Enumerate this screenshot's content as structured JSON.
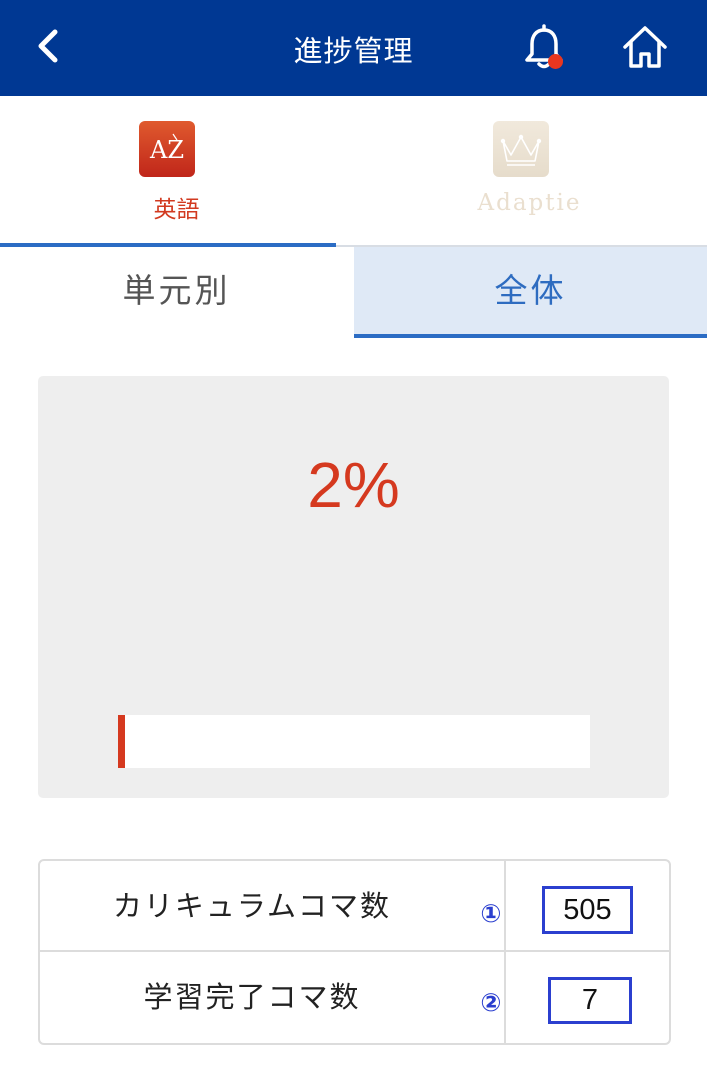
{
  "header": {
    "title": "進捗管理",
    "back_icon": "chevron-left-icon",
    "bell_icon": "bell-icon",
    "home_icon": "home-icon",
    "notification_color": "#e8361f",
    "background_color": "#003893"
  },
  "subjects": [
    {
      "id": "english",
      "label": "英語",
      "icon": "az-book-icon",
      "logo_text": "AZ",
      "selected": true,
      "color": "#d23a20"
    },
    {
      "id": "adaptie",
      "label": "Adaptie",
      "icon": "crown-icon",
      "selected": false,
      "color": "#eadfcf"
    }
  ],
  "view_tabs": [
    {
      "label": "単元別",
      "selected": false
    },
    {
      "label": "全体",
      "selected": true
    }
  ],
  "progress": {
    "percent_text": "2%",
    "fraction": 0.014,
    "color": "#d5391f"
  },
  "stats": [
    {
      "label": "カリキュラムコマ数",
      "marker": "①",
      "value": "505"
    },
    {
      "label": "学習完了コマ数",
      "marker": "②",
      "value": "7"
    }
  ],
  "accent_color": "#2b6cc4",
  "annotation_color": "#2b3fcf"
}
